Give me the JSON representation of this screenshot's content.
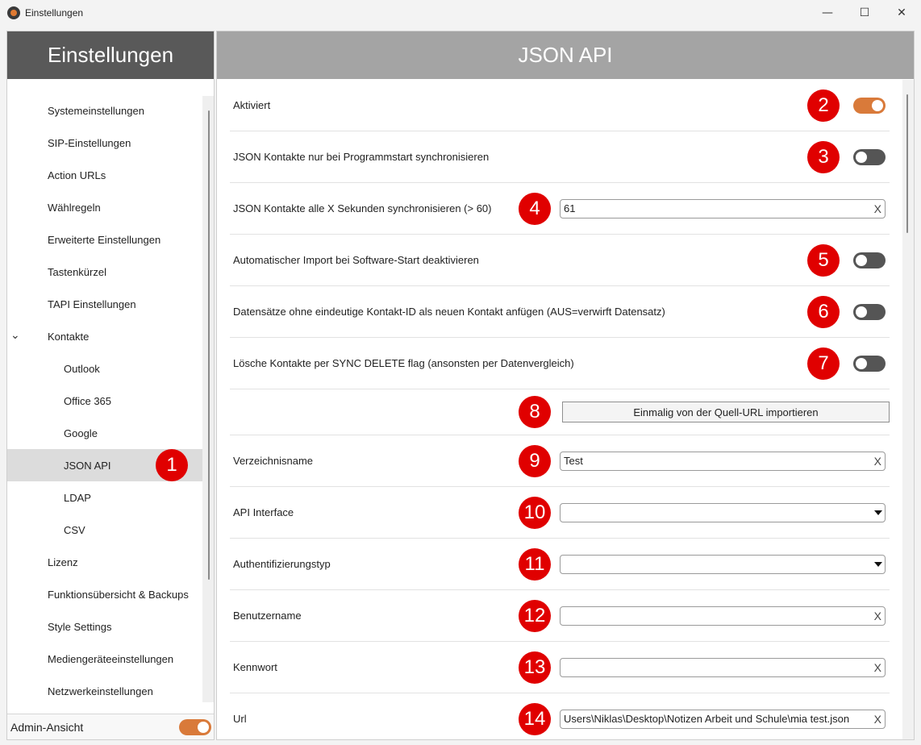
{
  "window": {
    "title": "Einstellungen",
    "minimize_glyph": "—",
    "maximize_glyph": "☐",
    "close_glyph": "✕"
  },
  "sidebar": {
    "title": "Einstellungen",
    "chevron": "⌄",
    "items": [
      {
        "label": "Systemeinstellungen"
      },
      {
        "label": "SIP-Einstellungen"
      },
      {
        "label": "Action URLs"
      },
      {
        "label": "Wählregeln"
      },
      {
        "label": "Erweiterte Einstellungen"
      },
      {
        "label": "Tastenkürzel"
      },
      {
        "label": "TAPI Einstellungen"
      },
      {
        "label": "Kontakte"
      },
      {
        "label": "Outlook"
      },
      {
        "label": "Office 365"
      },
      {
        "label": "Google"
      },
      {
        "label": "JSON API"
      },
      {
        "label": "LDAP"
      },
      {
        "label": "CSV"
      },
      {
        "label": "Lizenz"
      },
      {
        "label": "Funktionsübersicht & Backups"
      },
      {
        "label": "Style Settings"
      },
      {
        "label": "Mediengeräteeinstellungen"
      },
      {
        "label": "Netzwerkeinstellungen"
      }
    ],
    "admin_label": "Admin-Ansicht",
    "admin_enabled": true
  },
  "main": {
    "title": "JSON API",
    "activated_label": "Aktiviert",
    "activated": true,
    "sync_on_start_label": "JSON Kontakte nur bei Programmstart synchronisieren",
    "sync_on_start": false,
    "sync_interval_label": "JSON Kontakte alle X Sekunden synchronisieren (> 60)",
    "sync_interval_value": "61",
    "disable_auto_import_label": "Automatischer Import bei Software-Start deaktivieren",
    "disable_auto_import": false,
    "append_without_id_label": "Datensätze ohne eindeutige Kontakt-ID als neuen Kontakt anfügen (AUS=verwirft Datensatz)",
    "append_without_id": false,
    "delete_sync_flag_label": "Lösche Kontakte per SYNC DELETE flag (ansonsten per Datenvergleich)",
    "delete_sync_flag": false,
    "import_button_label": "Einmalig von der Quell-URL importieren",
    "directory_name_label": "Verzeichnisname",
    "directory_name_value": "Test",
    "api_interface_label": "API Interface",
    "api_interface_value": "",
    "auth_type_label": "Authentifizierungstyp",
    "auth_type_value": "",
    "username_label": "Benutzername",
    "username_value": "",
    "password_label": "Kennwort",
    "password_value": "",
    "url_label": "Url",
    "url_value": "Users\\Niklas\\Desktop\\Notizen Arbeit und Schule\\mia test.json",
    "clear_glyph": "X"
  },
  "markers": [
    "1",
    "2",
    "3",
    "4",
    "5",
    "6",
    "7",
    "8",
    "9",
    "10",
    "11",
    "12",
    "13",
    "14"
  ],
  "colors": {
    "accent": "#d97a3a",
    "marker": "#e00000",
    "sidebar_header": "#595959",
    "main_header": "#a4a4a4"
  }
}
